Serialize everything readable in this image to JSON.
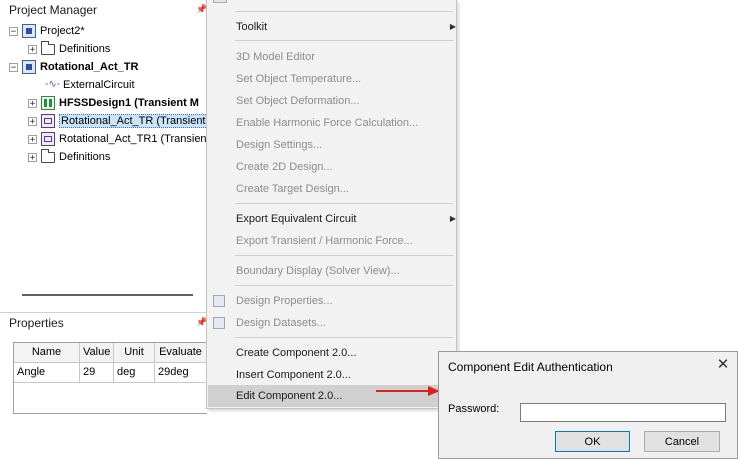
{
  "project_manager": {
    "title": "Project Manager",
    "tree": [
      {
        "label": "Project2*",
        "icon": "project-icon",
        "bold": false
      },
      {
        "label": "Definitions",
        "icon": "folder-icon",
        "bold": false
      },
      {
        "label": "Rotational_Act_TR",
        "icon": "project-icon",
        "bold": true
      },
      {
        "label": "ExternalCircuit",
        "icon": "circuit-icon",
        "bold": false
      },
      {
        "label": "HFSSDesign1 (Transient M",
        "icon": "hfss-design-icon",
        "bold": true
      },
      {
        "label": "Rotational_Act_TR (Transient",
        "icon": "maxwell-design-icon",
        "bold": false,
        "selected": true
      },
      {
        "label": "Rotational_Act_TR1 (Transien",
        "icon": "maxwell-design-icon",
        "bold": false
      },
      {
        "label": "Definitions",
        "icon": "folder-icon",
        "bold": false
      }
    ]
  },
  "properties": {
    "title": "Properties",
    "columns": [
      "Name",
      "Value",
      "Unit",
      "Evaluate"
    ],
    "rows": [
      [
        "Angle",
        "29",
        "deg",
        "29deg"
      ]
    ]
  },
  "context_menu": {
    "items": [
      {
        "label": "Toolkit",
        "disabled": false,
        "submenu": true
      },
      {
        "label": "3D Model Editor",
        "disabled": true
      },
      {
        "label": "Set Object Temperature...",
        "disabled": true
      },
      {
        "label": "Set Object Deformation...",
        "disabled": true
      },
      {
        "label": "Enable Harmonic Force Calculation...",
        "disabled": true
      },
      {
        "label": "Design Settings...",
        "disabled": true
      },
      {
        "label": "Create 2D Design...",
        "disabled": true
      },
      {
        "label": "Create Target Design...",
        "disabled": true
      },
      {
        "label": "Export Equivalent Circuit",
        "disabled": false,
        "submenu": true
      },
      {
        "label": "Export Transient / Harmonic Force...",
        "disabled": true
      },
      {
        "label": "Boundary Display (Solver View)...",
        "disabled": true
      },
      {
        "label": "Design Properties...",
        "disabled": true,
        "icon": "properties-icon"
      },
      {
        "label": "Design Datasets...",
        "disabled": true,
        "icon": "datasets-icon"
      },
      {
        "label": "Create Component 2.0...",
        "disabled": false
      },
      {
        "label": "Insert Component 2.0...",
        "disabled": false
      },
      {
        "label": "Edit Component 2.0...",
        "disabled": false,
        "highlighted": true
      }
    ]
  },
  "dialog": {
    "title": "Component Edit Authentication",
    "password_label": "Password:",
    "password_value": "",
    "ok_label": "OK",
    "cancel_label": "Cancel"
  },
  "colors": {
    "selection": "#cce4f7",
    "menu_background": "#f2f2f2",
    "menu_highlight": "#d0d0d0",
    "arrow": "#e02020",
    "ok_border": "#0078d7"
  }
}
